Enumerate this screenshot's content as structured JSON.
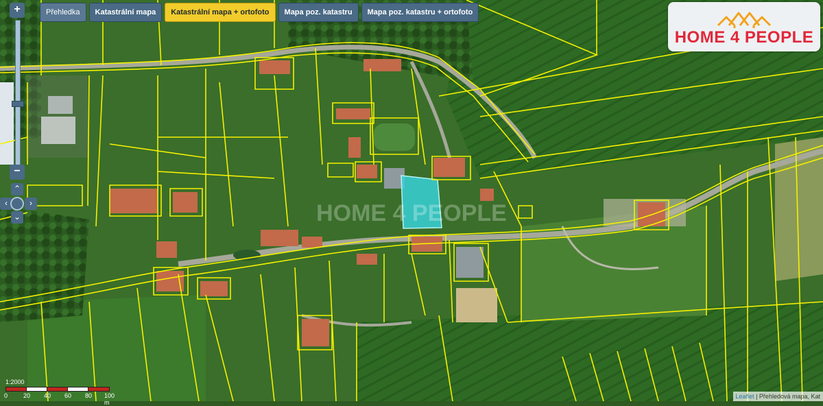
{
  "tabs": [
    {
      "label": "Přehledka",
      "active": false
    },
    {
      "label": "Katastrální mapa",
      "active": false
    },
    {
      "label": "Katastrální mapa + ortofoto",
      "active": true
    },
    {
      "label": "Mapa poz. katastru",
      "active": false
    },
    {
      "label": "Mapa poz. katastru + ortofoto",
      "active": false
    }
  ],
  "logo": {
    "text": "HOME 4 PEOPLE"
  },
  "watermark": "HOME 4 PEOPLE",
  "controls": {
    "zoom_in": "+",
    "zoom_out": "−",
    "pan_up": "⌃",
    "pan_down": "⌄",
    "pan_left": "‹",
    "pan_right": "›"
  },
  "scale": {
    "ratio": "1:2000",
    "labels": [
      "0",
      "20",
      "40",
      "60",
      "80",
      "100 m"
    ]
  },
  "attribution": {
    "link": "Leaflet",
    "text": "| Přehledová mapa, Kat"
  },
  "colors": {
    "parcel_line": "#f5f000",
    "highlight": "#38d1d8",
    "logo_red": "#e2273a",
    "tab_active": "#f2cc2a",
    "tab_default": "#4a6a86"
  }
}
